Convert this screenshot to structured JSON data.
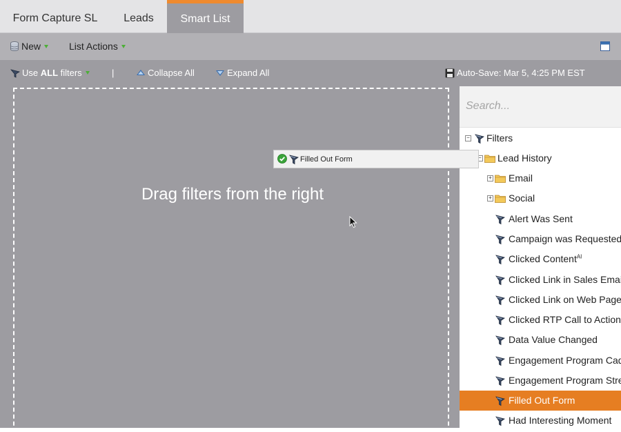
{
  "tabs": [
    {
      "label": "Form Capture SL"
    },
    {
      "label": "Leads"
    },
    {
      "label": "Smart List",
      "active": true
    }
  ],
  "toolbar": {
    "new_label": "New",
    "list_actions_label": "List Actions"
  },
  "filterbar": {
    "use_prefix": "Use ",
    "use_bold": "ALL",
    "use_suffix": " filters",
    "separator": "|",
    "collapse_label": "Collapse All",
    "expand_label": "Expand All",
    "autosave": "Auto-Save: Mar 5, 4:25 PM EST"
  },
  "canvas": {
    "drop_hint": "Drag filters from the right",
    "drag_ghost_label": "Filled Out Form"
  },
  "search": {
    "placeholder": "Search..."
  },
  "tree": {
    "root": "Filters",
    "group": "Lead History",
    "folders": [
      "Email",
      "Social"
    ],
    "items": [
      {
        "label": "Alert Was Sent"
      },
      {
        "label": "Campaign was Requested"
      },
      {
        "label": "Clicked Content",
        "sup": "AI"
      },
      {
        "label": "Clicked Link in Sales Email"
      },
      {
        "label": "Clicked Link on Web Page"
      },
      {
        "label": "Clicked RTP Call to Action"
      },
      {
        "label": "Data Value Changed"
      },
      {
        "label": "Engagement Program Cadence Changed"
      },
      {
        "label": "Engagement Program Stream Changed"
      },
      {
        "label": "Filled Out Form",
        "selected": true
      },
      {
        "label": "Had Interesting Moment"
      }
    ]
  },
  "colors": {
    "accent": "#ef8a2e",
    "selected_row": "#e67e22",
    "canvas": "#9d9ca1",
    "toolbar": "#b2b1b5"
  }
}
